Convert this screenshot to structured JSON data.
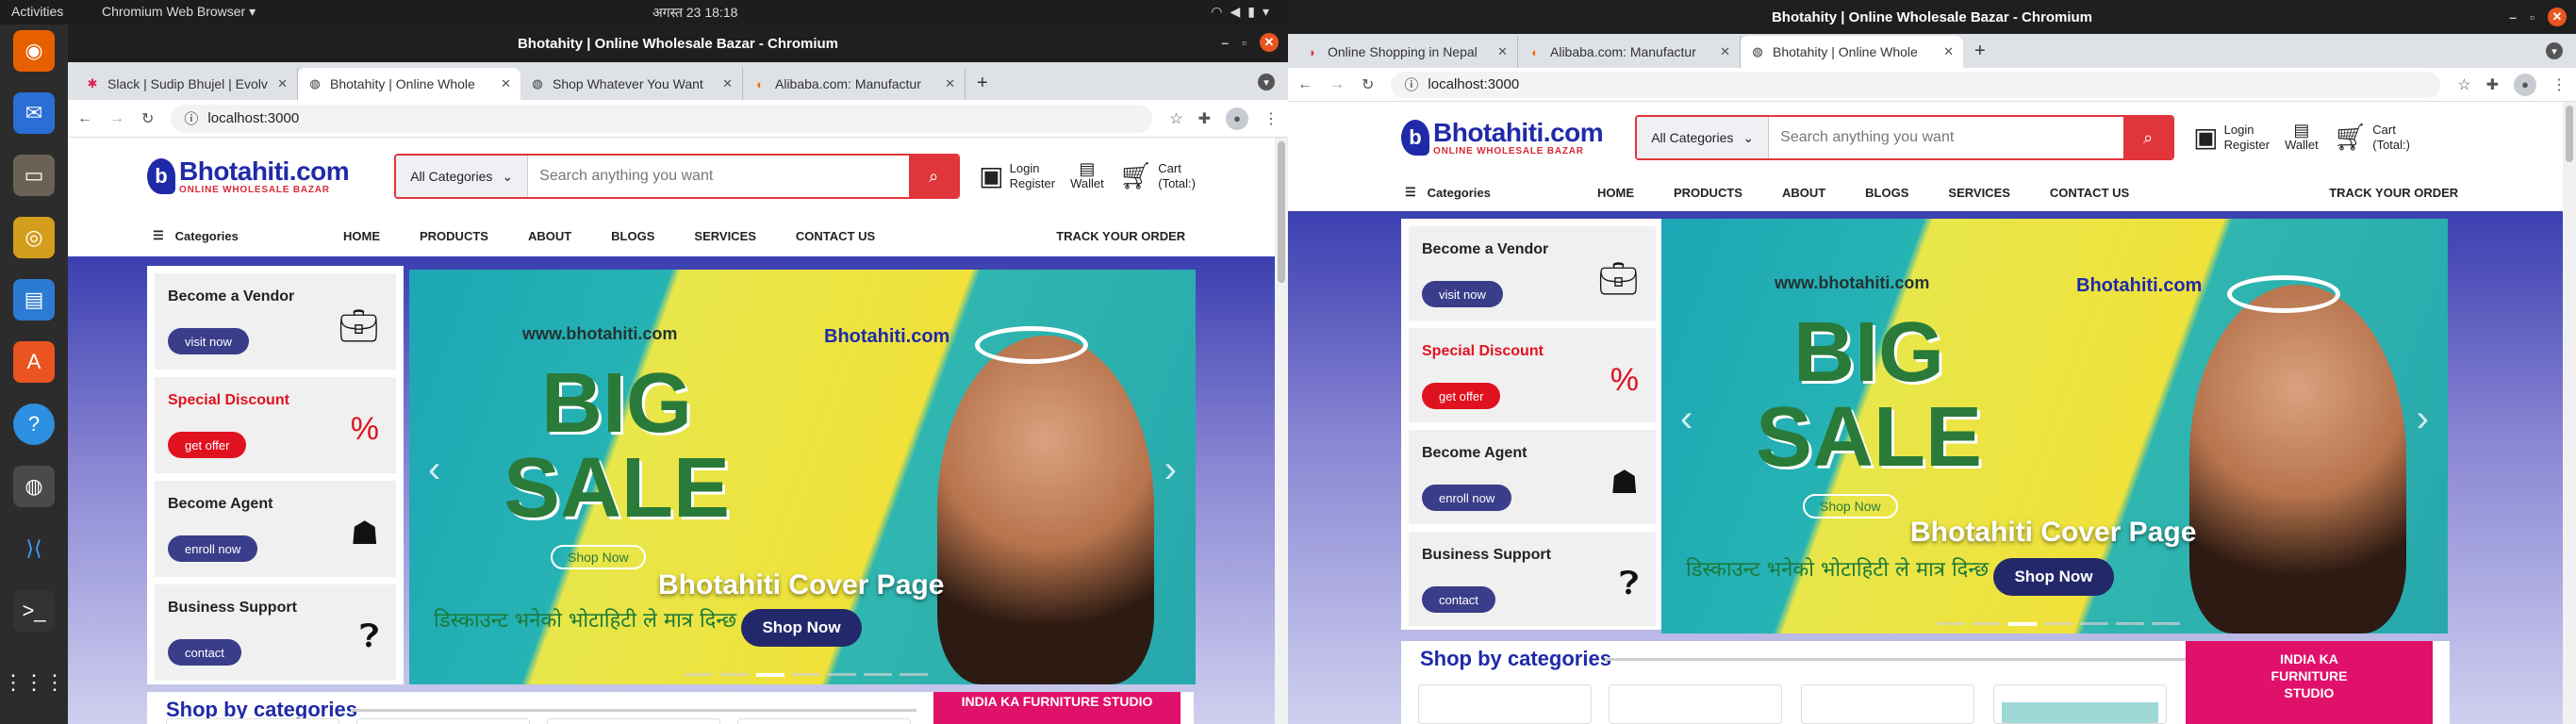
{
  "system": {
    "activities": "Activities",
    "app_menu": "Chromium Web Browser",
    "clock": "अगस्त 23  18:18"
  },
  "left": {
    "title": "Bhotahity | Online Wholesale Bazar - Chromium",
    "tabs": [
      "Slack | Sudip Bhujel | Evolv",
      "Bhotahity | Online Whole",
      "Shop Whatever You Want",
      "Alibaba.com: Manufactur"
    ],
    "url": "localhost:3000",
    "search_category": "All Categories",
    "search_placeholder": "Search anything you want",
    "login": "Login",
    "register": "Register",
    "wallet": "Wallet",
    "cart": "Cart",
    "cart_total": "(Total:)",
    "categories": "Categories",
    "nav": [
      "HOME",
      "PRODUCTS",
      "ABOUT",
      "BLOGS",
      "SERVICES",
      "CONTACT US"
    ],
    "track": "TRACK YOUR ORDER",
    "cards": [
      {
        "title": "Become a Vendor",
        "button": "visit now"
      },
      {
        "title": "Special Discount",
        "button": "get offer"
      },
      {
        "title": "Become Agent",
        "button": "enroll now"
      },
      {
        "title": "Business Support",
        "button": "contact"
      }
    ],
    "banner": {
      "www": "www.bhotahiti.com",
      "big": "BIG",
      "sale": "SALE",
      "logo": "Bhotahiti.com",
      "hindi": "डिस्काउन्ट भनेको भोटाहिटी ले मात्र दिन्छ",
      "caption": "Bhotahiti Cover Page",
      "shop": "Shop Now",
      "art_shop": "Shop Now"
    },
    "shop_by": "Shop by categories",
    "promo": [
      "INDIA KA",
      "FURNITURE",
      "STUDIO"
    ]
  },
  "right": {
    "title": "Bhotahity | Online Wholesale Bazar - Chromium",
    "tabs": [
      "Online Shopping in Nepal",
      "Alibaba.com: Manufactur",
      "Bhotahity | Online Whole"
    ],
    "url": "localhost:3000",
    "search_category": "All Categories",
    "search_placeholder": "Search anything you want",
    "login": "Login",
    "register": "Register",
    "wallet": "Wallet",
    "cart": "Cart",
    "cart_total": "(Total:)",
    "categories": "Categories",
    "nav": [
      "HOME",
      "PRODUCTS",
      "ABOUT",
      "BLOGS",
      "SERVICES",
      "CONTACT US"
    ],
    "track": "TRACK YOUR ORDER",
    "cards": [
      {
        "title": "Become a Vendor",
        "button": "visit now"
      },
      {
        "title": "Special Discount",
        "button": "get offer"
      },
      {
        "title": "Become Agent",
        "button": "enroll now"
      },
      {
        "title": "Business Support",
        "button": "contact"
      }
    ],
    "banner": {
      "www": "www.bhotahiti.com",
      "big": "BIG",
      "sale": "SALE",
      "logo": "Bhotahiti.com",
      "hindi": "डिस्काउन्ट भनेको भोटाहिटी ले मात्र दिन्छ",
      "caption": "Bhotahiti Cover Page",
      "shop": "Shop Now",
      "art_shop": "Shop Now"
    },
    "shop_by": "Shop by categories",
    "promo": [
      "INDIA KA",
      "FURNITURE",
      "STUDIO"
    ]
  },
  "brand": {
    "name": "Bhotahiti.com",
    "tagline": "ONLINE WHOLESALE BAZAR"
  },
  "icons": {
    "vendor": "briefcase-icon",
    "discount": "percent-icon",
    "agent": "agent-icon",
    "support": "question-icon"
  },
  "colors": {
    "brand_blue": "#1f2aa8",
    "accent_red": "#e0363b",
    "button_navy": "#3a3d8a"
  }
}
